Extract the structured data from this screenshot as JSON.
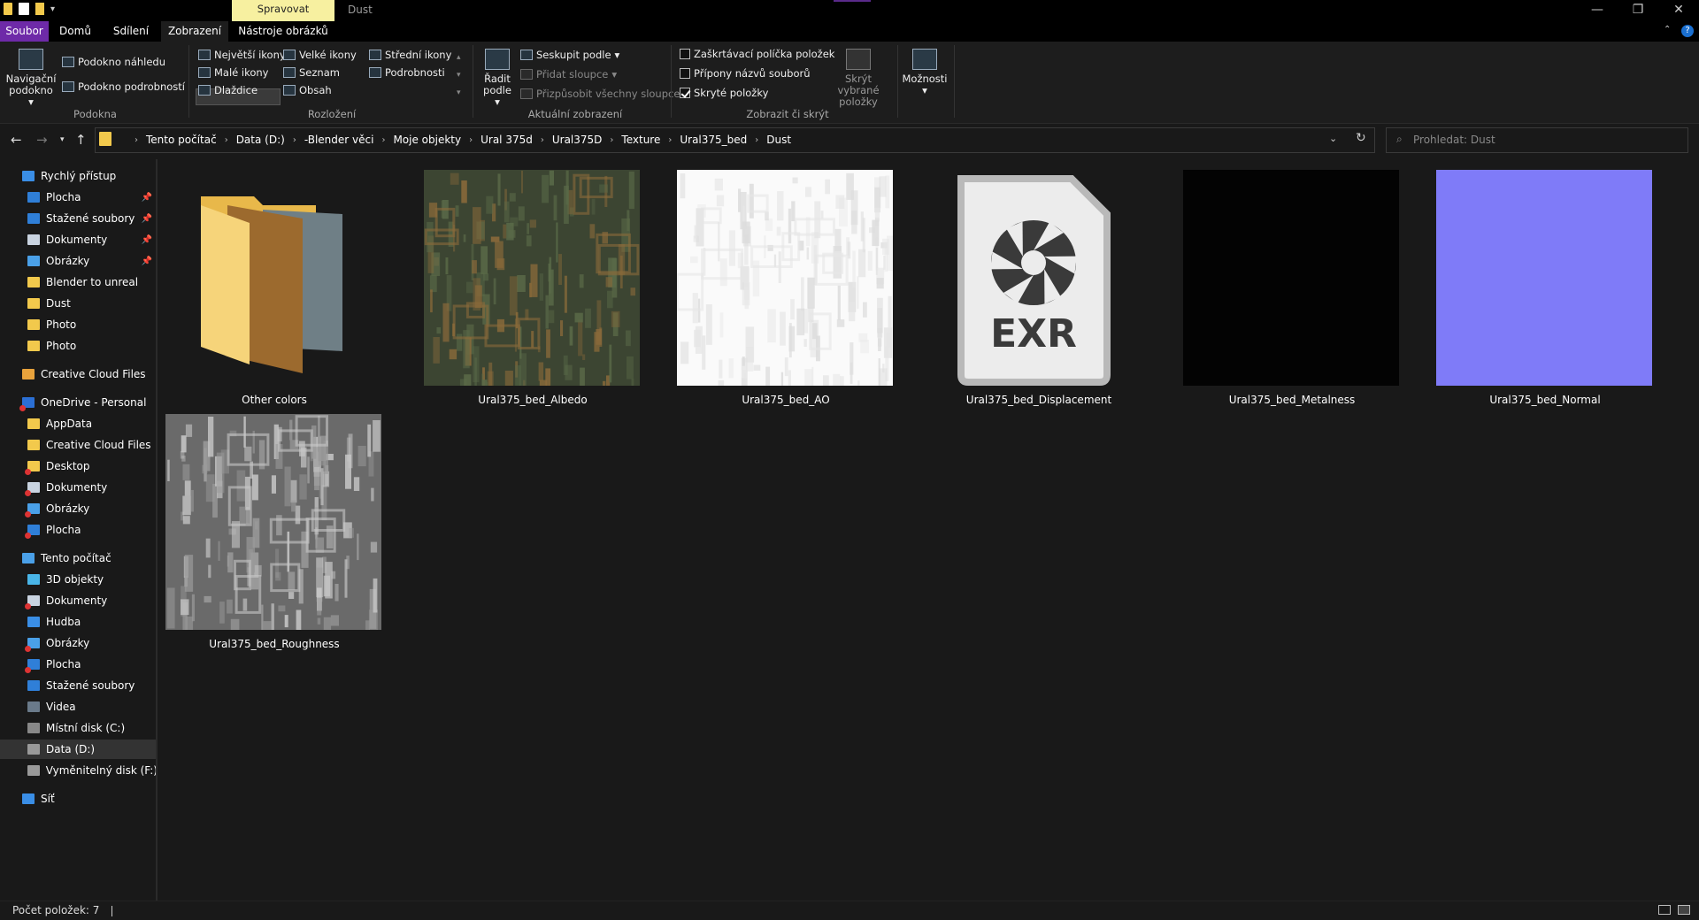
{
  "window": {
    "context_tab": "Spravovat",
    "title": "Dust",
    "controls": [
      "—",
      "❐",
      "✕"
    ]
  },
  "ribbon_tabs": [
    "Soubor",
    "Domů",
    "Sdílení",
    "Zobrazení",
    "Nástroje obrázků"
  ],
  "ribbon": {
    "pane": {
      "navigation_pane": "Navigační podokno",
      "preview_pane": "Podokno náhledu",
      "details_pane": "Podokno podrobností",
      "group": "Podokna"
    },
    "layout": {
      "extra_large": "Největší ikony",
      "large": "Velké ikony",
      "medium": "Střední ikony",
      "small": "Malé ikony",
      "list": "Seznam",
      "details": "Podrobnosti",
      "tiles": "Dlaždice",
      "content": "Obsah",
      "group": "Rozložení"
    },
    "current_view": {
      "sort_by": "Řadit podle",
      "group_by": "Seskupit podle",
      "add_columns": "Přidat sloupce",
      "fit_columns": "Přizpůsobit všechny sloupce",
      "group": "Aktuální zobrazení"
    },
    "show_hide": {
      "item_checkboxes": "Zaškrtávací políčka položek",
      "file_extensions": "Přípony názvů souborů",
      "hidden_items": "Skryté položky",
      "hide_selected": "Skrýt vybrané položky",
      "group": "Zobrazit či skrýt",
      "checked": [
        false,
        false,
        true
      ]
    },
    "options": "Možnosti"
  },
  "address": {
    "crumbs": [
      "Tento počítač",
      "Data (D:)",
      "-Blender věci",
      "Moje objekty",
      "Ural 375d",
      "Ural375D",
      "Texture",
      "Ural375_bed",
      "Dust"
    ],
    "search_placeholder": "Prohledat: Dust"
  },
  "sidebar": {
    "quick_access": "Rychlý přístup",
    "quick_items": [
      "Plocha",
      "Stažené soubory",
      "Dokumenty",
      "Obrázky",
      "Blender to unreal",
      "Dust",
      "Photo",
      "Photo"
    ],
    "creative_cloud": "Creative Cloud Files",
    "onedrive": "OneDrive - Personal",
    "onedrive_items": [
      "AppData",
      "Creative Cloud Files",
      "Desktop",
      "Dokumenty",
      "Obrázky",
      "Plocha"
    ],
    "this_pc": "Tento počítač",
    "pc_items": [
      "3D objekty",
      "Dokumenty",
      "Hudba",
      "Obrázky",
      "Plocha",
      "Stažené soubory",
      "Videa",
      "Místní disk (C:)",
      "Data (D:)",
      "Vyměnitelný disk (F:)"
    ],
    "network": "Síť"
  },
  "files": [
    {
      "name": "Other colors",
      "kind": "folder"
    },
    {
      "name": "Ural375_bed_Albedo",
      "kind": "albedo"
    },
    {
      "name": "Ural375_bed_AO",
      "kind": "ao"
    },
    {
      "name": "Ural375_bed_Displacement",
      "kind": "exr"
    },
    {
      "name": "Ural375_bed_Metalness",
      "kind": "metal"
    },
    {
      "name": "Ural375_bed_Normal",
      "kind": "normal"
    },
    {
      "name": "Ural375_bed_Roughness",
      "kind": "rough"
    }
  ],
  "exr_label": "EXR",
  "status": {
    "count": "Počet položek: 7"
  }
}
